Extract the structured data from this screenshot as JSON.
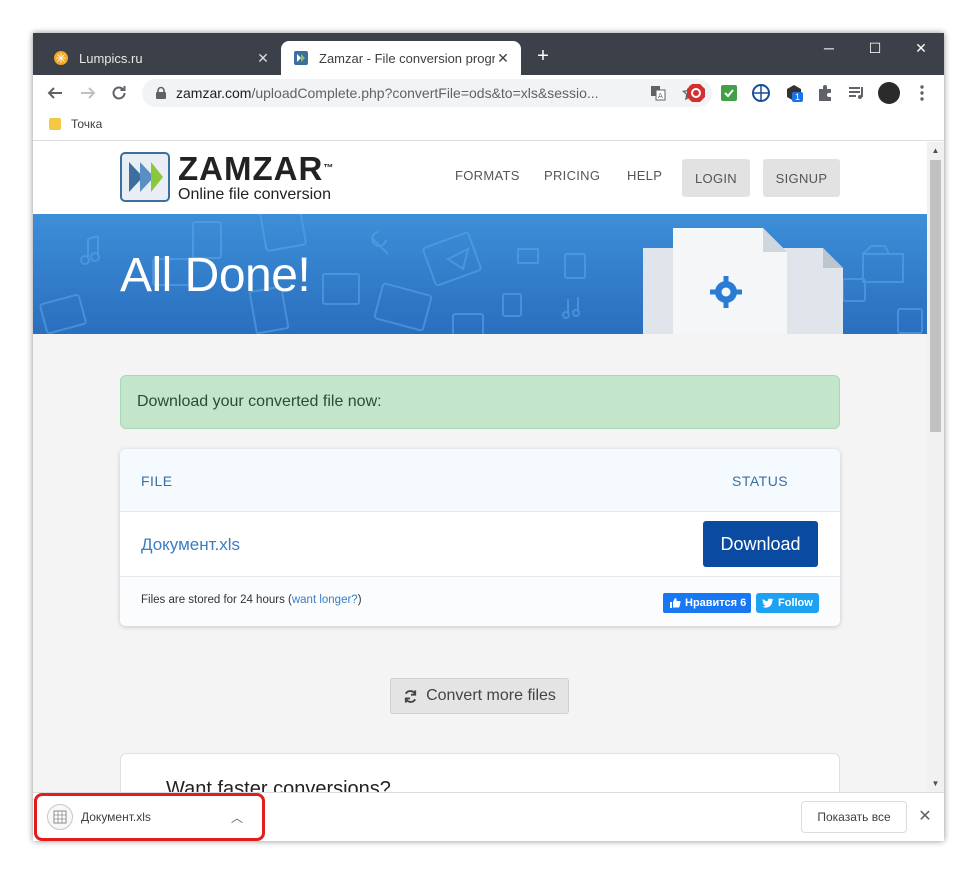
{
  "browser": {
    "tabs": [
      {
        "title": "Lumpics.ru",
        "close": "✕"
      },
      {
        "title": "Zamzar - File conversion progress",
        "close": "✕"
      }
    ],
    "new_tab": "+",
    "window_controls": {
      "minimize": "─",
      "maximize": "☐",
      "close": "✕"
    },
    "address": {
      "host": "zamzar.com",
      "path": "/uploadComplete.php?convertFile=ods&to=xls&sessio..."
    },
    "bookmarks": [
      {
        "label": "Точка"
      }
    ],
    "extension_badge": "1"
  },
  "site": {
    "brand_name": "ZAMZAR",
    "brand_tm": "™",
    "brand_tagline": "Online file conversion",
    "nav": {
      "formats": "FORMATS",
      "pricing": "PRICING",
      "help": "HELP",
      "login": "LOGIN",
      "signup": "SIGNUP"
    },
    "hero_title": "All Done!",
    "notice": "Download your converted file now:",
    "table": {
      "col_file": "FILE",
      "col_status": "STATUS",
      "rows": [
        {
          "file": "Документ.xls",
          "action": "Download"
        }
      ],
      "storage_note_prefix": "Files are stored for 24 hours (",
      "storage_link": "want longer?",
      "storage_note_suffix": ")",
      "fb_like": "Нравится 6",
      "tw_follow": "Follow"
    },
    "convert_more": "Convert more files",
    "faster_heading": "Want faster conversions?"
  },
  "downloads": {
    "items": [
      {
        "filename": "Документ.xls"
      }
    ],
    "show_all": "Показать все"
  },
  "colors": {
    "tab_strip": "#3c4149",
    "hero_blue": "#2a6fbf",
    "download_button": "#0a4aa0",
    "notice_green": "#c3e6cb",
    "highlight_red": "#e11d1d"
  }
}
